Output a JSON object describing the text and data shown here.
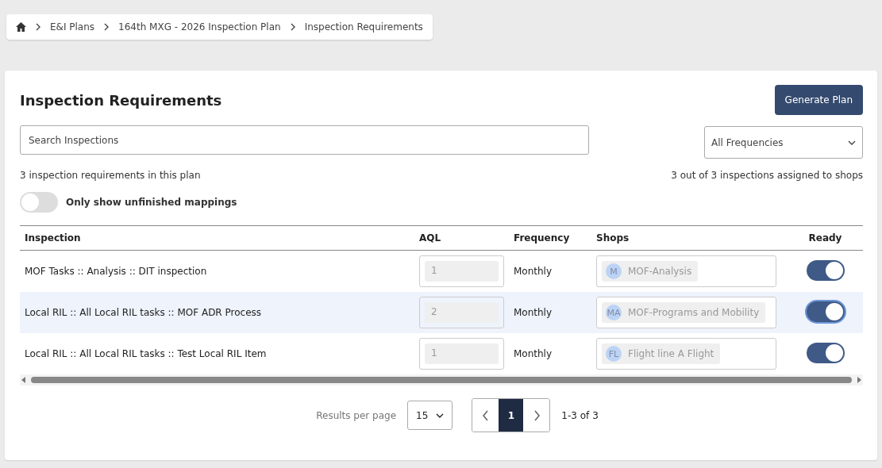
{
  "breadcrumb": [
    "E&I Plans",
    "164th MXG - 2026 Inspection Plan",
    "Inspection Requirements"
  ],
  "title": "Inspection Requirements",
  "generate_button": "Generate Plan",
  "search": {
    "placeholder": "Search Inspections"
  },
  "frequency_filter": {
    "value": "All Frequencies"
  },
  "summary_left": "3 inspection requirements in this plan",
  "summary_right": "3 out of 3 inspections assigned to shops",
  "unfinished_toggle": {
    "label": "Only show unfinished mappings",
    "on": false
  },
  "table": {
    "columns": [
      "Inspection",
      "AQL",
      "Frequency",
      "Shops",
      "Ready"
    ],
    "rows": [
      {
        "inspection": "MOF Tasks :: Analysis :: DIT inspection",
        "aql": "1",
        "frequency": "Monthly",
        "shop_initials": "M",
        "shop": "MOF-Analysis",
        "ready": true,
        "selected": false
      },
      {
        "inspection": "Local RIL :: All Local RIL tasks :: MOF ADR Process",
        "aql": "2",
        "frequency": "Monthly",
        "shop_initials": "MA",
        "shop": "MOF-Programs and Mobility",
        "ready": true,
        "selected": true
      },
      {
        "inspection": "Local RIL :: All Local RIL tasks :: Test Local RIL Item",
        "aql": "1",
        "frequency": "Monthly",
        "shop_initials": "FL",
        "shop": "Flight line A Flight",
        "ready": true,
        "selected": false
      }
    ]
  },
  "pagination": {
    "results_label": "Results per page",
    "page_size": "15",
    "pages": [
      {
        "label": "1",
        "selected": true
      }
    ],
    "range": "1-3 of 3"
  }
}
